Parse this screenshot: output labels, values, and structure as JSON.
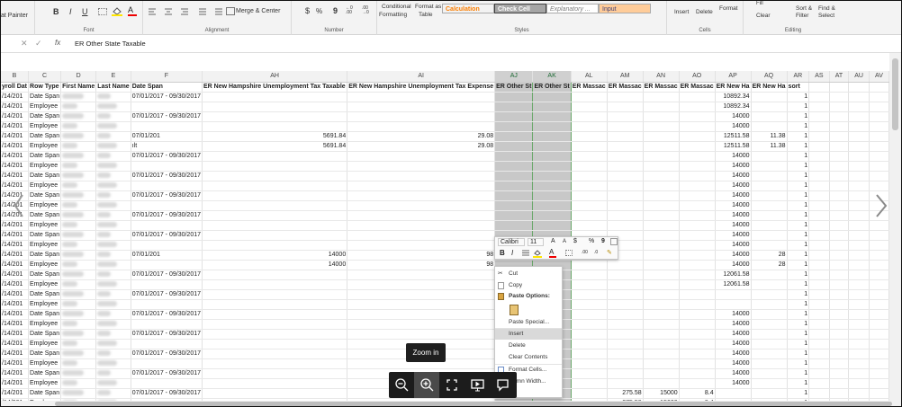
{
  "ribbon": {
    "format_painter": "at Painter",
    "font_group": "Font",
    "alignment_group": "Alignment",
    "number_group": "Number",
    "styles_group": "Styles",
    "cells_group": "Cells",
    "editing_group": "Editing",
    "merge_center": "Merge & Center",
    "currency_symbol": "$",
    "percent_symbol": "%",
    "comma_symbol": "9",
    "conditional_formatting_1": "Conditional",
    "conditional_formatting_2": "Formatting",
    "format_as_table_1": "Format as",
    "format_as_table_2": "Table",
    "style_calculation": "Calculation",
    "style_check_cell": "Check Cell",
    "style_explanatory": "Explanatory ...",
    "style_input": "Input",
    "insert": "Insert",
    "delete": "Delete",
    "format": "Format",
    "fill": "Fill",
    "clear": "Clear",
    "sort_filter_1": "Sort &",
    "sort_filter_2": "Filter",
    "find_select_1": "Find &",
    "find_select_2": "Select",
    "colors": {
      "calculation_bg": "#f2f2f2",
      "calculation_fg": "#fa7d00",
      "check_bg": "#a5a5a5",
      "input_bg": "#ffcc99"
    }
  },
  "formula_bar": {
    "fx": "fx",
    "content": "ER Other State Taxable"
  },
  "column_headers": [
    "B",
    "C",
    "D",
    "E",
    "F",
    "AH",
    "AI",
    "AJ",
    "AK",
    "AL",
    "AM",
    "AN",
    "AO",
    "AP",
    "AQ",
    "AR",
    "AS",
    "AT",
    "AU",
    "AV"
  ],
  "header_row": [
    "yroll Dat",
    "Row Type",
    "First Name",
    "Last Name",
    "Date Span",
    "ER New Hampshire Unemployment Tax Taxable",
    "ER New Hampshire Unemployment Tax Expense",
    "ER Other St",
    "ER Other St",
    "ER Massac",
    "ER Massac",
    "ER Massac",
    "ER Massac",
    "ER New Ha",
    "ER New Ha",
    "sort",
    "",
    "",
    "",
    ""
  ],
  "rows": [
    {
      "b": "/14/201",
      "c": "Date Span",
      "f": "07/01/2017 - 09/30/2017",
      "ah": "",
      "ai": "",
      "am": "",
      "an": "",
      "ao": "",
      "ap": "10892.34",
      "aq": "",
      "ar": "1"
    },
    {
      "b": "/14/201",
      "c": "Employee",
      "f": "",
      "ah": "",
      "ai": "",
      "am": "",
      "an": "",
      "ao": "",
      "ap": "10892.34",
      "aq": "",
      "ar": "1"
    },
    {
      "b": "/14/201",
      "c": "Date Span",
      "f": "07/01/2017 - 09/30/2017",
      "ah": "",
      "ai": "",
      "am": "",
      "an": "",
      "ao": "",
      "ap": "14000",
      "aq": "",
      "ar": "1"
    },
    {
      "b": "/14/201",
      "c": "Employee",
      "f": "",
      "ah": "",
      "ai": "",
      "am": "",
      "an": "",
      "ao": "",
      "ap": "14000",
      "aq": "",
      "ar": "1"
    },
    {
      "b": "/14/201",
      "c": "Date Span",
      "f": "07/01/201",
      "ah": "5691.84",
      "ai": "29.08",
      "am": "",
      "an": "",
      "ao": "",
      "ap": "12511.58",
      "aq": "11.38",
      "ar": "1"
    },
    {
      "b": "/14/201",
      "c": "Employee",
      "f": "ılt",
      "ah": "5691.84",
      "ai": "29.08",
      "am": "",
      "an": "",
      "ao": "",
      "ap": "12511.58",
      "aq": "11.38",
      "ar": "1"
    },
    {
      "b": "/14/201",
      "c": "Date Span",
      "f": "07/01/2017 - 09/30/2017",
      "ah": "",
      "ai": "",
      "am": "",
      "an": "",
      "ao": "",
      "ap": "14000",
      "aq": "",
      "ar": "1"
    },
    {
      "b": "/14/201",
      "c": "Employee",
      "f": "",
      "ah": "",
      "ai": "",
      "am": "",
      "an": "",
      "ao": "",
      "ap": "14000",
      "aq": "",
      "ar": "1"
    },
    {
      "b": "/14/201",
      "c": "Date Span",
      "f": "07/01/2017 - 09/30/2017",
      "ah": "",
      "ai": "",
      "am": "",
      "an": "",
      "ao": "",
      "ap": "14000",
      "aq": "",
      "ar": "1"
    },
    {
      "b": "/14/201",
      "c": "Employee",
      "f": "",
      "ah": "",
      "ai": "",
      "am": "",
      "an": "",
      "ao": "",
      "ap": "14000",
      "aq": "",
      "ar": "1"
    },
    {
      "b": "/14/201",
      "c": "Date Span",
      "f": "07/01/2017 - 09/30/2017",
      "ah": "",
      "ai": "",
      "am": "",
      "an": "",
      "ao": "",
      "ap": "14000",
      "aq": "",
      "ar": "1"
    },
    {
      "b": "/14/201",
      "c": "Employee",
      "f": "",
      "ah": "",
      "ai": "",
      "am": "",
      "an": "",
      "ao": "",
      "ap": "14000",
      "aq": "",
      "ar": "1"
    },
    {
      "b": "/14/201",
      "c": "Date Span",
      "f": "07/01/2017 - 09/30/2017",
      "ah": "",
      "ai": "",
      "am": "",
      "an": "",
      "ao": "",
      "ap": "14000",
      "aq": "",
      "ar": "1"
    },
    {
      "b": "/14/201",
      "c": "Employee",
      "f": "",
      "ah": "",
      "ai": "",
      "am": "",
      "an": "",
      "ao": "",
      "ap": "14000",
      "aq": "",
      "ar": "1"
    },
    {
      "b": "/14/201",
      "c": "Date Span",
      "f": "07/01/2017 - 09/30/2017",
      "ah": "",
      "ai": "",
      "am": "",
      "an": "",
      "ao": "",
      "ap": "14000",
      "aq": "",
      "ar": "1"
    },
    {
      "b": "/14/201",
      "c": "Employee",
      "f": "",
      "ah": "",
      "ai": "",
      "am": "",
      "an": "",
      "ao": "",
      "ap": "14000",
      "aq": "",
      "ar": "1"
    },
    {
      "b": "/14/201",
      "c": "Date Span",
      "f": "07/01/201",
      "ah": "14000",
      "ai": "98",
      "am": "",
      "an": "",
      "ao": "",
      "ap": "14000",
      "aq": "28",
      "ar": "1"
    },
    {
      "b": "/14/201",
      "c": "Employee",
      "f": "",
      "ah": "14000",
      "ai": "98",
      "am": "",
      "an": "",
      "ao": "",
      "ap": "14000",
      "aq": "28",
      "ar": "1"
    },
    {
      "b": "/14/201",
      "c": "Date Span",
      "f": "07/01/2017 - 09/30/2017",
      "ah": "",
      "ai": "",
      "am": "",
      "an": "",
      "ao": "",
      "ap": "12061.58",
      "aq": "",
      "ar": "1"
    },
    {
      "b": "/14/201",
      "c": "Employee",
      "f": "",
      "ah": "",
      "ai": "",
      "am": "",
      "an": "",
      "ao": "",
      "ap": "12061.58",
      "aq": "",
      "ar": "1"
    },
    {
      "b": "/14/201",
      "c": "Date Span",
      "f": "07/01/2017 - 09/30/2017",
      "ah": "",
      "ai": "",
      "am": "",
      "an": "",
      "ao": "",
      "ap": "",
      "aq": "",
      "ar": "1"
    },
    {
      "b": "/14/201",
      "c": "Employee",
      "f": "",
      "ah": "",
      "ai": "",
      "am": "",
      "an": "",
      "ao": "",
      "ap": "",
      "aq": "",
      "ar": "1"
    },
    {
      "b": "/14/201",
      "c": "Date Span",
      "f": "07/01/2017 - 09/30/2017",
      "ah": "",
      "ai": "",
      "am": "",
      "an": "",
      "ao": "",
      "ap": "14000",
      "aq": "",
      "ar": "1"
    },
    {
      "b": "/14/201",
      "c": "Employee",
      "f": "",
      "ah": "",
      "ai": "",
      "am": "",
      "an": "",
      "ao": "",
      "ap": "14000",
      "aq": "",
      "ar": "1"
    },
    {
      "b": "/14/201",
      "c": "Date Span",
      "f": "07/01/2017 - 09/30/2017",
      "ah": "",
      "ai": "",
      "am": "",
      "an": "",
      "ao": "",
      "ap": "14000",
      "aq": "",
      "ar": "1"
    },
    {
      "b": "/14/201",
      "c": "Employee",
      "f": "",
      "ah": "",
      "ai": "",
      "am": "",
      "an": "",
      "ao": "",
      "ap": "14000",
      "aq": "",
      "ar": "1"
    },
    {
      "b": "/14/201",
      "c": "Date Span",
      "f": "07/01/2017 - 09/30/2017",
      "ah": "",
      "ai": "",
      "am": "",
      "an": "",
      "ao": "",
      "ap": "14000",
      "aq": "",
      "ar": "1"
    },
    {
      "b": "/14/201",
      "c": "Employee",
      "f": "",
      "ah": "",
      "ai": "",
      "am": "",
      "an": "",
      "ao": "",
      "ap": "14000",
      "aq": "",
      "ar": "1"
    },
    {
      "b": "/14/201",
      "c": "Date Span",
      "f": "07/01/2017 - 09/30/2017",
      "ah": "",
      "ai": "",
      "am": "",
      "an": "",
      "ao": "",
      "ap": "14000",
      "aq": "",
      "ar": "1"
    },
    {
      "b": "/14/201",
      "c": "Employee",
      "f": "",
      "ah": "",
      "ai": "",
      "am": "",
      "an": "",
      "ao": "",
      "ap": "14000",
      "aq": "",
      "ar": "1"
    },
    {
      "b": "/14/201",
      "c": "Date Span",
      "f": "07/01/2017 - 09/30/2017",
      "ah": "",
      "ai": "",
      "am": "275.58",
      "an": "15000",
      "ao": "8.4",
      "ap": "",
      "aq": "",
      "ar": "1"
    },
    {
      "b": "/14/201",
      "c": "Employee",
      "f": "",
      "ah": "",
      "ai": "",
      "am": "275.58",
      "an": "15000",
      "ao": "8.4",
      "ap": "",
      "aq": "",
      "ar": "1"
    },
    {
      "b": "/14/201",
      "c": "Date Span",
      "f": "07/01/2017 - 09/30/2017",
      "ah": "",
      "ai": "",
      "am": "",
      "an": "",
      "ao": "",
      "ap": "14000",
      "aq": "",
      "ar": "1"
    }
  ],
  "mini_toolbar": {
    "font": "Calibri",
    "size": "11",
    "grow": "A",
    "shrink": "A",
    "dollar": "$",
    "percent": "%",
    "comma": "9",
    "bold": "B",
    "italic": "I"
  },
  "context_menu": {
    "cut": "Cut",
    "copy": "Copy",
    "paste_options": "Paste Options:",
    "paste_special": "Paste Special...",
    "insert": "Insert",
    "delete": "Delete",
    "clear_contents": "Clear Contents",
    "format_cells": "Format Cells...",
    "column_width": "olumn Width...",
    "hide": "de"
  },
  "zoom_tooltip": "Zoom in"
}
